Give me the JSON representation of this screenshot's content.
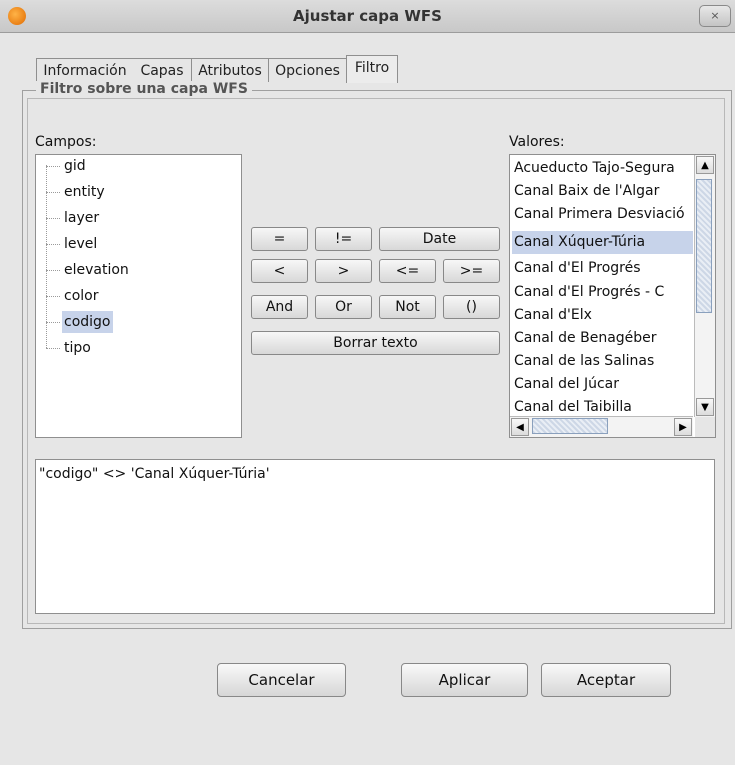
{
  "window": {
    "title": "Ajustar capa WFS",
    "close_label": "×"
  },
  "tabs": [
    {
      "label": "Información",
      "selected": false
    },
    {
      "label": "Capas",
      "selected": false
    },
    {
      "label": "Atributos",
      "selected": false
    },
    {
      "label": "Opciones",
      "selected": false
    },
    {
      "label": "Filtro",
      "selected": true
    }
  ],
  "group_title": "Filtro sobre una capa WFS",
  "campos": {
    "label": "Campos:",
    "items": [
      "gid",
      "entity",
      "layer",
      "level",
      "elevation",
      "color",
      "codigo",
      "tipo"
    ],
    "selected": "codigo"
  },
  "operators": {
    "eq": "=",
    "neq": "!=",
    "date": "Date",
    "lt": "<",
    "gt": ">",
    "le": "<=",
    "ge": ">=",
    "and": "And",
    "or": "Or",
    "not": "Not",
    "paren": "()",
    "clear": "Borrar texto"
  },
  "valores": {
    "label": "Valores:",
    "items": [
      "Acueducto Tajo-Segura",
      "Canal Baix de l'Algar",
      "Canal Primera Desviació",
      "Canal Xúquer-Túria",
      "Canal d'El Progrés",
      "Canal d'El Progrés - C",
      "Canal d'Elx",
      "Canal de Benagéber",
      "Canal de las Salinas",
      "Canal del Júcar",
      "Canal del Taibilla"
    ],
    "selected": "Canal Xúquer-Túria"
  },
  "expression": "\"codigo\" <> 'Canal Xúquer-Túria'",
  "buttons": {
    "cancel": "Cancelar",
    "apply": "Aplicar",
    "accept": "Aceptar"
  }
}
